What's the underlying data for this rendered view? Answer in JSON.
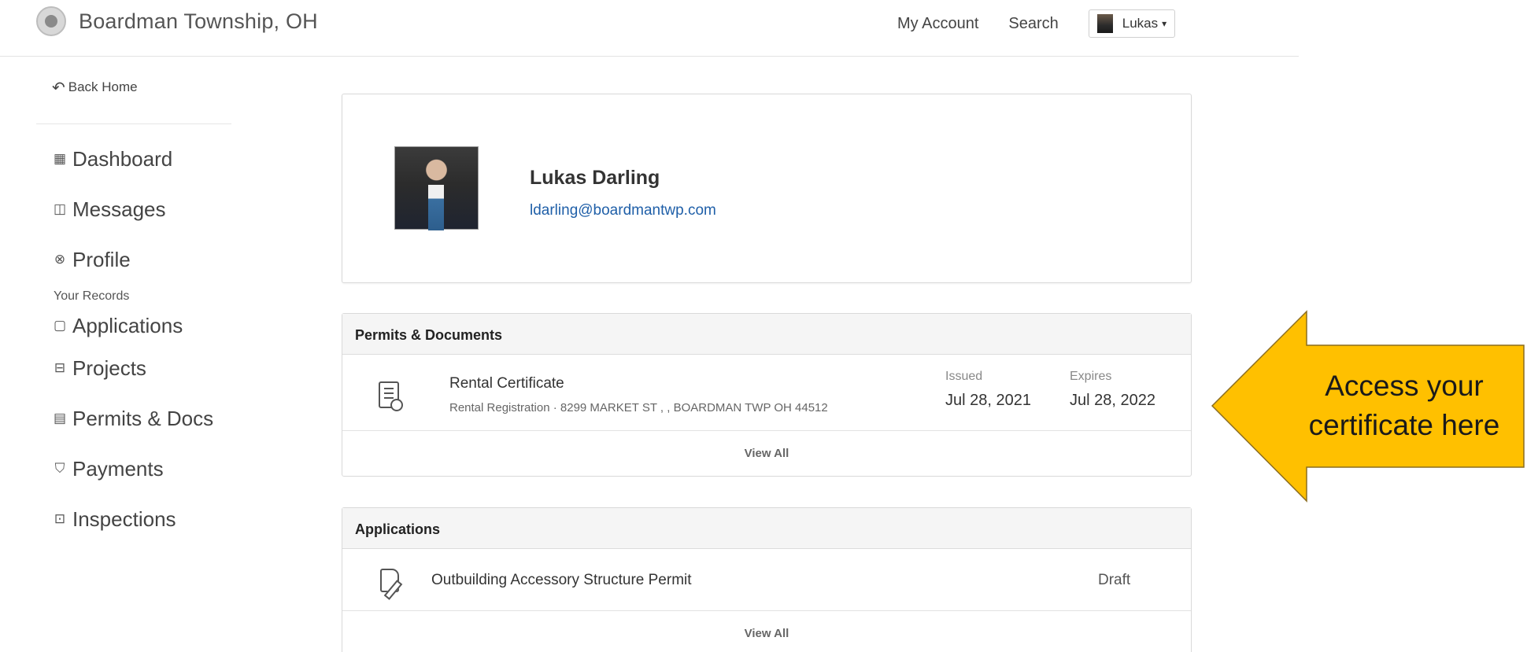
{
  "header": {
    "site_title": "Boardman Township, OH",
    "nav": {
      "my_account": "My Account",
      "search": "Search"
    },
    "user": {
      "name": "Lukas",
      "caret": "▾"
    }
  },
  "sidebar": {
    "back_home": "Back Home",
    "items": [
      {
        "label": "Dashboard",
        "icon": "▦"
      },
      {
        "label": "Messages",
        "icon": "◫"
      },
      {
        "label": "Profile",
        "icon": "⊗"
      }
    ],
    "records_label": "Your Records",
    "records": [
      {
        "label": "Applications",
        "icon": "▢"
      },
      {
        "label": "Projects",
        "icon": "⊟"
      },
      {
        "label": "Permits & Docs",
        "icon": "▤"
      },
      {
        "label": "Payments",
        "icon": "⛉"
      },
      {
        "label": "Inspections",
        "icon": "⊡"
      }
    ]
  },
  "profile": {
    "name": "Lukas Darling",
    "email": "ldarling@boardmantwp.com"
  },
  "permits": {
    "heading": "Permits & Documents",
    "item": {
      "title": "Rental Certificate",
      "subtitle": "Rental Registration · 8299 MARKET ST , , BOARDMAN TWP OH 44512",
      "issued_label": "Issued",
      "issued_value": "Jul 28, 2021",
      "expires_label": "Expires",
      "expires_value": "Jul 28, 2022"
    },
    "view_all": "View All"
  },
  "applications": {
    "heading": "Applications",
    "item": {
      "title": "Outbuilding Accessory Structure Permit",
      "status": "Draft"
    },
    "view_all": "View All"
  },
  "callout": {
    "text": "Access your certificate here",
    "fill": "#FFC000",
    "stroke": "#8B6D1F"
  }
}
